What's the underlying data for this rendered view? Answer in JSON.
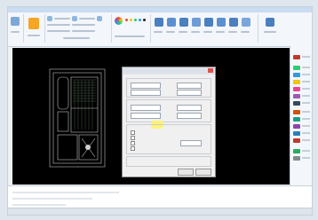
{
  "app": {
    "title": ""
  },
  "dialog": {
    "title": "",
    "ok_label": "",
    "cancel_label": ""
  },
  "colors": {
    "canvas": "#000000",
    "ribbon": "#f3f6fa",
    "highlight": "#fff36b",
    "accent_icon": "#f5a623"
  },
  "icons": {
    "ribbon": [
      "app-menu-icon",
      "layer-icon",
      "color-wheel-icon",
      "properties-icon"
    ],
    "right_panel": [
      "palette-icon"
    ]
  }
}
